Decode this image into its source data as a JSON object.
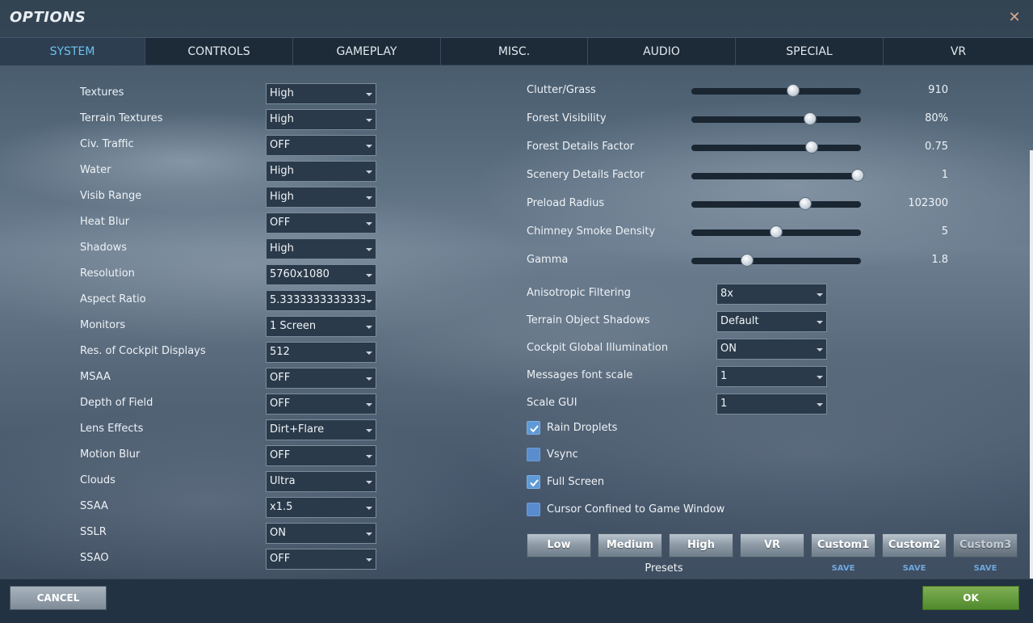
{
  "window": {
    "title": "OPTIONS",
    "close_glyph": "✕"
  },
  "tabs": [
    {
      "label": "SYSTEM",
      "active": true
    },
    {
      "label": "CONTROLS"
    },
    {
      "label": "GAMEPLAY"
    },
    {
      "label": "MISC."
    },
    {
      "label": "AUDIO"
    },
    {
      "label": "SPECIAL"
    },
    {
      "label": "VR"
    }
  ],
  "left_settings": [
    {
      "label": "Textures",
      "value": "High"
    },
    {
      "label": "Terrain Textures",
      "value": "High"
    },
    {
      "label": "Civ. Traffic",
      "value": "OFF"
    },
    {
      "label": "Water",
      "value": "High"
    },
    {
      "label": "Visib Range",
      "value": "High"
    },
    {
      "label": "Heat Blur",
      "value": "OFF"
    },
    {
      "label": "Shadows",
      "value": "High"
    },
    {
      "label": "Resolution",
      "value": "5760x1080"
    },
    {
      "label": "Aspect Ratio",
      "value": "5.3333333333333"
    },
    {
      "label": "Monitors",
      "value": "1 Screen"
    },
    {
      "label": "Res. of Cockpit Displays",
      "value": "512"
    },
    {
      "label": "MSAA",
      "value": "OFF"
    },
    {
      "label": "Depth of Field",
      "value": "OFF"
    },
    {
      "label": "Lens Effects",
      "value": "Dirt+Flare"
    },
    {
      "label": "Motion Blur",
      "value": "OFF"
    },
    {
      "label": "Clouds",
      "value": "Ultra"
    },
    {
      "label": "SSAA",
      "value": "x1.5"
    },
    {
      "label": "SSLR",
      "value": "ON"
    },
    {
      "label": "SSAO",
      "value": "OFF"
    }
  ],
  "sliders": [
    {
      "label": "Clutter/Grass",
      "value": "910",
      "level": 0.6
    },
    {
      "label": "Forest Visibility",
      "value": "80%",
      "level": 0.7
    },
    {
      "label": "Forest Details Factor",
      "value": "0.75",
      "level": 0.71
    },
    {
      "label": "Scenery Details Factor",
      "value": "1",
      "level": 0.98
    },
    {
      "label": "Preload Radius",
      "value": "102300",
      "level": 0.67
    },
    {
      "label": "Chimney Smoke Density",
      "value": "5",
      "level": 0.5
    },
    {
      "label": "Gamma",
      "value": "1.8",
      "level": 0.33
    }
  ],
  "right_selects": [
    {
      "label": "Anisotropic Filtering",
      "value": "8x"
    },
    {
      "label": "Terrain Object Shadows",
      "value": "Default"
    },
    {
      "label": "Cockpit Global Illumination",
      "value": "ON"
    },
    {
      "label": "Messages font scale",
      "value": "1"
    },
    {
      "label": "Scale GUI",
      "value": "1"
    }
  ],
  "checkboxes": [
    {
      "label": "Rain Droplets",
      "checked": true
    },
    {
      "label": "Vsync",
      "checked": false
    },
    {
      "label": "Full Screen",
      "checked": true
    },
    {
      "label": "Cursor Confined to Game Window",
      "checked": false
    }
  ],
  "presets": {
    "label": "Presets",
    "buttons": [
      {
        "label": "Low"
      },
      {
        "label": "Medium"
      },
      {
        "label": "High"
      },
      {
        "label": "VR"
      },
      {
        "label": "Custom1",
        "save": "SAVE"
      },
      {
        "label": "Custom2",
        "save": "SAVE"
      },
      {
        "label": "Custom3",
        "save": "SAVE",
        "dim": true
      }
    ]
  },
  "footer": {
    "cancel_label": "CANCEL",
    "ok_label": "OK"
  },
  "colors": {
    "active_tab_text": "#6ec1ef",
    "ok_green": "#5e962f",
    "checkbox_blue": "#5e9ad6",
    "save_blue": "#6fa7dd"
  },
  "icons": {
    "close": "close-icon",
    "dropdown": "chevron-down-icon",
    "check": "checkmark-icon"
  }
}
